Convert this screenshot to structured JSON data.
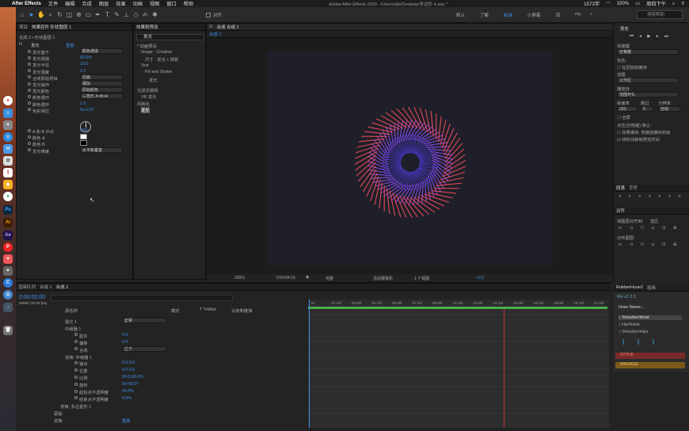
{
  "menubar": {
    "apple": "",
    "app": "After Effects",
    "items": [
      "文件",
      "编辑",
      "合成",
      "图层",
      "效果",
      "动画",
      "视图",
      "窗口",
      "帮助"
    ],
    "right": [
      "1573字",
      "100%",
      "周四下午"
    ]
  },
  "toolbar": {
    "align": "对齐",
    "title": "Adobe After Effects 2020 - /Users/sjhi/Desktop/多边形 4.aep *",
    "workspaces": [
      "默认",
      "了解",
      "标准",
      "小屏幕",
      "库",
      "my"
    ],
    "selected_workspace": "标准",
    "search": "搜索帮助"
  },
  "project": {
    "tabs": [
      "项目",
      "效果控件 形状图层 1"
    ],
    "layer_path": "合成 2 • 形状图层 1",
    "effect": "发光",
    "props": [
      {
        "name": "发光基于",
        "value": "颜色通道",
        "type": "dd"
      },
      {
        "name": "发光阈值",
        "value": "80.0%",
        "type": "val"
      },
      {
        "name": "发光半径",
        "value": "10.0",
        "type": "val"
      },
      {
        "name": "发光强度",
        "value": "1.0",
        "type": "val"
      },
      {
        "name": "合成原始项目",
        "value": "后面",
        "type": "dd"
      },
      {
        "name": "发光操作",
        "value": "相加",
        "type": "dd"
      },
      {
        "name": "发光颜色",
        "value": "原始颜色",
        "type": "dd"
      },
      {
        "name": "颜色循环",
        "value": "三角形 A>B>A",
        "type": "dd"
      },
      {
        "name": "颜色循环",
        "value": "1.0",
        "type": "val"
      },
      {
        "name": "色彩相位",
        "value": "0x+0.0°",
        "type": "val"
      },
      {
        "name": "A 和 B 中点",
        "value": "50%",
        "type": "val"
      },
      {
        "name": "颜色 A",
        "value": "",
        "type": "swatch"
      },
      {
        "name": "颜色 B",
        "value": "",
        "type": "swatch"
      },
      {
        "name": "发光维度",
        "value": "水平和垂直",
        "type": "dd"
      }
    ]
  },
  "effects": {
    "title": "效果和预设",
    "search": "发光",
    "tree": [
      "* 动画预设",
      "Image - Creative",
      "尺寸 - 发光 + 阴影",
      "Text",
      "Fill and Stroke",
      "发光",
      "沉浸式视频",
      "VR 发光",
      "风格化",
      "发光"
    ]
  },
  "comp": {
    "tab_label": "合成 合成 2",
    "crumb": "合成 2",
    "zoom": "200%",
    "time": "0:00:04:19",
    "quality": "完整",
    "camera": "活动摄像机",
    "views": "1 个视图",
    "offset": "+0.0"
  },
  "preview": {
    "title": "预览",
    "shortcut_label": "快捷键",
    "shortcut": "空格键",
    "include": "包含:",
    "cache": "在回放前缓存",
    "range_label": "范围",
    "range": "工作区",
    "play_from_label": "播放自",
    "play_from": "范围开头",
    "fps_label": "帧速率",
    "skip_label": "跳过",
    "res_label": "分辨率",
    "fps": "(30)",
    "skip": "0",
    "res": "自动",
    "fullscreen": "全屏",
    "stop_label": "点击(空格键) 停止:",
    "opt1": "如果缓存, 则播放缓存的帧",
    "opt2": "将时间移到预览时间"
  },
  "paragraph": {
    "tabs": [
      "段落",
      "字符"
    ]
  },
  "align": {
    "title": "对齐",
    "align_to": "将图层对齐到:",
    "sel": "选区",
    "dist": "分布图层:"
  },
  "timeline": {
    "tabs": [
      "渲染队列",
      "合成 1",
      "合成 2"
    ],
    "time": "0:00:00:00",
    "fps": "00000 (30.00 fps)",
    "cols": [
      "源名称",
      "模式",
      "T TrkMat",
      "父级和链接"
    ],
    "rows": [
      {
        "indent": 0,
        "name": "属光 1",
        "value": "正常",
        "type": "dd"
      },
      {
        "indent": 0,
        "name": "中继器 1",
        "value": "",
        "type": "none"
      },
      {
        "indent": 1,
        "name": "副本",
        "value": "6.0",
        "type": "val"
      },
      {
        "indent": 1,
        "name": "偏移",
        "value": "0.0",
        "type": "val"
      },
      {
        "indent": 1,
        "name": "合成",
        "value": "之下",
        "type": "dd"
      },
      {
        "indent": 0,
        "name": "变换: 中继器 1",
        "value": "",
        "type": "none"
      },
      {
        "indent": 1,
        "name": "锚点",
        "value": "0.0,0.0",
        "type": "val"
      },
      {
        "indent": 1,
        "name": "位置",
        "value": "0.0,0.0",
        "type": "val"
      },
      {
        "indent": 1,
        "name": "比例",
        "value": "90.0,90.0%",
        "type": "val"
      },
      {
        "indent": 1,
        "name": "旋转",
        "value": "0x+60.0°",
        "type": "val"
      },
      {
        "indent": 1,
        "name": "起始点不透明度",
        "value": "90.0%",
        "type": "val"
      },
      {
        "indent": 1,
        "name": "结束点不透明度",
        "value": "0.0%",
        "type": "val"
      },
      {
        "indent": -1,
        "name": "变换: 多边星形 1",
        "value": "",
        "type": "none"
      },
      {
        "indent": -2,
        "name": "蒙版",
        "value": "",
        "type": "none"
      },
      {
        "indent": -2,
        "name": "变换",
        "value": "重置",
        "type": "val"
      }
    ],
    "ticks": [
      "0s",
      "01:15f",
      "03:00f",
      "04:15f",
      "06:00f",
      "07:15f",
      "09:00f",
      "10:15f",
      "12:00f",
      "13:15f",
      "15:00f",
      "16:15f",
      "18:00f",
      "19:15f",
      "21:00f"
    ]
  },
  "rubberhose": {
    "tab": "RubberHose2",
    "tab2": "插画",
    "version": "RH v2.2.3",
    "hose_name": "Hose Name...",
    "items": [
      "Shoulder/Wrist",
      "Hip/Ankle",
      "Shoulder/Hips"
    ],
    "style": "STYLE",
    "manage": "MANAGE"
  }
}
